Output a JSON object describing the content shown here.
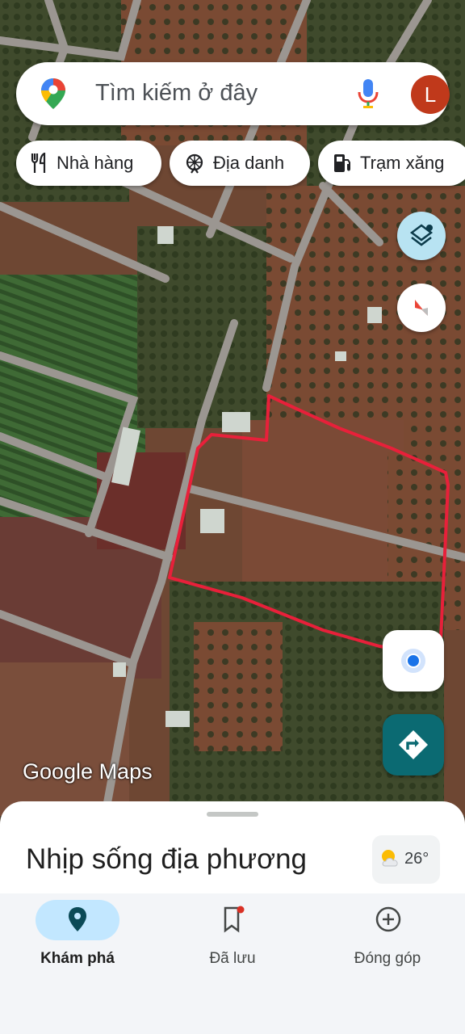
{
  "search": {
    "placeholder": "Tìm kiếm ở đây",
    "avatar_letter": "L"
  },
  "chips": [
    {
      "label": "Nhà hàng",
      "icon": "restaurant-icon"
    },
    {
      "label": "Địa danh",
      "icon": "attraction-icon"
    },
    {
      "label": "Trạm xăng",
      "icon": "gas-station-icon"
    }
  ],
  "map": {
    "attribution": "Google Maps",
    "boundary_color": "#e8203a"
  },
  "sheet": {
    "title": "Nhịp sống địa phương",
    "weather_temp": "26°"
  },
  "nav": {
    "items": [
      {
        "label": "Khám phá",
        "icon": "explore-pin-icon",
        "active": true
      },
      {
        "label": "Đã lưu",
        "icon": "bookmark-icon",
        "active": false
      },
      {
        "label": "Đóng góp",
        "icon": "add-circle-icon",
        "active": false
      }
    ]
  },
  "colors": {
    "accent": "#c2e7ff",
    "directions": "#0b6a72",
    "avatar": "#c0391b"
  }
}
